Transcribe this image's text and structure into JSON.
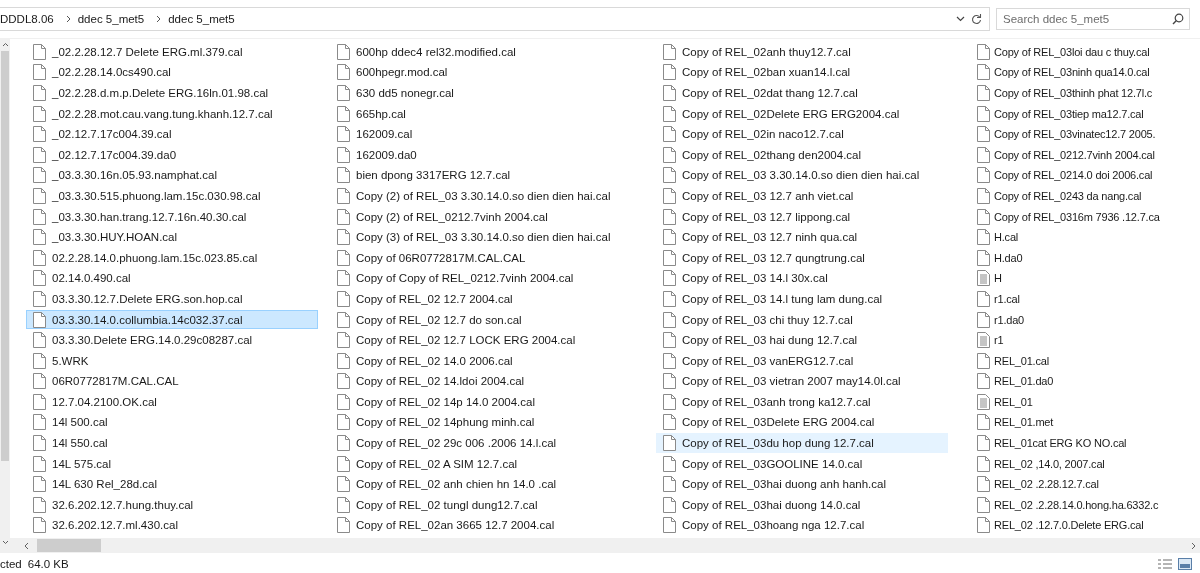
{
  "address_bar": {
    "breadcrumbs": [
      "DDDL8.06",
      "ddec 5_met5",
      "ddec 5_met5"
    ]
  },
  "search": {
    "placeholder": "Search ddec 5_met5"
  },
  "columns": [
    [
      {
        "name": "_02.2.28.12.7 Delete ERG.ml.379.cal",
        "kind": "file",
        "selected": false,
        "hot": false
      },
      {
        "name": "_02.2.28.14.0cs490.cal",
        "kind": "file",
        "selected": false,
        "hot": false
      },
      {
        "name": "_02.2.28.d.m.p.Delete ERG.16ln.01.98.cal",
        "kind": "file",
        "selected": false,
        "hot": false
      },
      {
        "name": "_02.2.28.mot.cau.vang.tung.khanh.12.7.cal",
        "kind": "file",
        "selected": false,
        "hot": false
      },
      {
        "name": "_02.12.7.17c004.39.cal",
        "kind": "file",
        "selected": false,
        "hot": false
      },
      {
        "name": "_02.12.7.17c004.39.da0",
        "kind": "file",
        "selected": false,
        "hot": false
      },
      {
        "name": "_03.3.30.16n.05.93.namphat.cal",
        "kind": "file",
        "selected": false,
        "hot": false
      },
      {
        "name": "_03.3.30.515.phuong.lam.15c.030.98.cal",
        "kind": "file",
        "selected": false,
        "hot": false
      },
      {
        "name": "_03.3.30.han.trang.12.7.16n.40.30.cal",
        "kind": "file",
        "selected": false,
        "hot": false
      },
      {
        "name": "_03.3.30.HUY.HOAN.cal",
        "kind": "file",
        "selected": false,
        "hot": false
      },
      {
        "name": "02.2.28.14.0.phuong.lam.15c.023.85.cal",
        "kind": "file",
        "selected": false,
        "hot": false
      },
      {
        "name": "02.14.0.490.cal",
        "kind": "file",
        "selected": false,
        "hot": false
      },
      {
        "name": "03.3.30.12.7.Delete ERG.son.hop.cal",
        "kind": "file",
        "selected": false,
        "hot": false
      },
      {
        "name": "03.3.30.14.0.collumbia.14c032.37.cal",
        "kind": "file",
        "selected": true,
        "hot": false
      },
      {
        "name": "03.3.30.Delete ERG.14.0.29c08287.cal",
        "kind": "file",
        "selected": false,
        "hot": false
      },
      {
        "name": "5.WRK",
        "kind": "file",
        "selected": false,
        "hot": false
      },
      {
        "name": "06R0772817M.CAL.CAL",
        "kind": "file",
        "selected": false,
        "hot": false
      },
      {
        "name": "12.7.04.2100.OK.cal",
        "kind": "file",
        "selected": false,
        "hot": false
      },
      {
        "name": "14l 500.cal",
        "kind": "file",
        "selected": false,
        "hot": false
      },
      {
        "name": "14l 550.cal",
        "kind": "file",
        "selected": false,
        "hot": false
      },
      {
        "name": "14L 575.cal",
        "kind": "file",
        "selected": false,
        "hot": false
      },
      {
        "name": "14L 630 Rel_28d.cal",
        "kind": "file",
        "selected": false,
        "hot": false
      },
      {
        "name": "32.6.202.12.7.hung.thuy.cal",
        "kind": "file",
        "selected": false,
        "hot": false
      },
      {
        "name": "32.6.202.12.7.ml.430.cal",
        "kind": "file",
        "selected": false,
        "hot": false
      }
    ],
    [
      {
        "name": "600hp ddec4 rel32.modified.cal",
        "kind": "file",
        "selected": false,
        "hot": false
      },
      {
        "name": "600hpegr.mod.cal",
        "kind": "file",
        "selected": false,
        "hot": false
      },
      {
        "name": "630 dd5 nonegr.cal",
        "kind": "file",
        "selected": false,
        "hot": false
      },
      {
        "name": "665hp.cal",
        "kind": "file",
        "selected": false,
        "hot": false
      },
      {
        "name": "162009.cal",
        "kind": "file",
        "selected": false,
        "hot": false
      },
      {
        "name": "162009.da0",
        "kind": "file",
        "selected": false,
        "hot": false
      },
      {
        "name": "bien dpong 3317ERG 12.7.cal",
        "kind": "file",
        "selected": false,
        "hot": false
      },
      {
        "name": "Copy (2) of REL_03 3.30.14.0.so dien dien hai.cal",
        "kind": "file",
        "selected": false,
        "hot": false
      },
      {
        "name": "Copy (2) of REL_0212.7vinh 2004.cal",
        "kind": "file",
        "selected": false,
        "hot": false
      },
      {
        "name": "Copy (3) of REL_03 3.30.14.0.so dien dien hai.cal",
        "kind": "file",
        "selected": false,
        "hot": false
      },
      {
        "name": "Copy of 06R0772817M.CAL.CAL",
        "kind": "file",
        "selected": false,
        "hot": false
      },
      {
        "name": "Copy of Copy of REL_0212.7vinh 2004.cal",
        "kind": "file",
        "selected": false,
        "hot": false
      },
      {
        "name": "Copy of REL_02 12.7 2004.cal",
        "kind": "file",
        "selected": false,
        "hot": false
      },
      {
        "name": "Copy of REL_02 12.7 do son.cal",
        "kind": "file",
        "selected": false,
        "hot": false
      },
      {
        "name": "Copy of REL_02 12.7 LOCK ERG 2004.cal",
        "kind": "file",
        "selected": false,
        "hot": false
      },
      {
        "name": "Copy of REL_02 14.0 2006.cal",
        "kind": "file",
        "selected": false,
        "hot": false
      },
      {
        "name": "Copy of REL_02 14.ldoi  2004.cal",
        "kind": "file",
        "selected": false,
        "hot": false
      },
      {
        "name": "Copy of REL_02 14p 14.0 2004.cal",
        "kind": "file",
        "selected": false,
        "hot": false
      },
      {
        "name": "Copy of REL_02 14phung minh.cal",
        "kind": "file",
        "selected": false,
        "hot": false
      },
      {
        "name": "Copy of REL_02 29c 006 .2006 14.l.cal",
        "kind": "file",
        "selected": false,
        "hot": false
      },
      {
        "name": "Copy of REL_02 A SIM 12.7.cal",
        "kind": "file",
        "selected": false,
        "hot": false
      },
      {
        "name": "Copy of REL_02 anh chien hn 14.0 .cal",
        "kind": "file",
        "selected": false,
        "hot": false
      },
      {
        "name": "Copy of REL_02 tungl dung12.7.cal",
        "kind": "file",
        "selected": false,
        "hot": false
      },
      {
        "name": "Copy of REL_02an 3665 12.7 2004.cal",
        "kind": "file",
        "selected": false,
        "hot": false
      }
    ],
    [
      {
        "name": "Copy of REL_02anh thuy12.7.cal",
        "kind": "file",
        "selected": false,
        "hot": false
      },
      {
        "name": "Copy of REL_02ban xuan14.l.cal",
        "kind": "file",
        "selected": false,
        "hot": false
      },
      {
        "name": "Copy of REL_02dat thang 12.7.cal",
        "kind": "file",
        "selected": false,
        "hot": false
      },
      {
        "name": "Copy of REL_02Delete ERG ERG2004.cal",
        "kind": "file",
        "selected": false,
        "hot": false
      },
      {
        "name": "Copy of REL_02in naco12.7.cal",
        "kind": "file",
        "selected": false,
        "hot": false
      },
      {
        "name": "Copy of REL_02thang den2004.cal",
        "kind": "file",
        "selected": false,
        "hot": false
      },
      {
        "name": "Copy of REL_03 3.30.14.0.so dien dien hai.cal",
        "kind": "file",
        "selected": false,
        "hot": false
      },
      {
        "name": "Copy of REL_03 12.7 anh viet.cal",
        "kind": "file",
        "selected": false,
        "hot": false
      },
      {
        "name": "Copy of REL_03 12.7 lippong.cal",
        "kind": "file",
        "selected": false,
        "hot": false
      },
      {
        "name": "Copy of REL_03 12.7 ninh qua.cal",
        "kind": "file",
        "selected": false,
        "hot": false
      },
      {
        "name": "Copy of REL_03 12.7 qungtrung.cal",
        "kind": "file",
        "selected": false,
        "hot": false
      },
      {
        "name": "Copy of REL_03 14.l 30x.cal",
        "kind": "file",
        "selected": false,
        "hot": false
      },
      {
        "name": "Copy of REL_03 14.l tung lam dung.cal",
        "kind": "file",
        "selected": false,
        "hot": false
      },
      {
        "name": "Copy of REL_03 chi thuy 12.7.cal",
        "kind": "file",
        "selected": false,
        "hot": false
      },
      {
        "name": "Copy of REL_03 hai dung 12.7.cal",
        "kind": "file",
        "selected": false,
        "hot": false
      },
      {
        "name": "Copy of REL_03 vanERG12.7.cal",
        "kind": "file",
        "selected": false,
        "hot": false
      },
      {
        "name": "Copy of REL_03 vietran 2007 may14.0l.cal",
        "kind": "file",
        "selected": false,
        "hot": false
      },
      {
        "name": "Copy of REL_03anh trong ka12.7.cal",
        "kind": "file",
        "selected": false,
        "hot": false
      },
      {
        "name": "Copy of REL_03Delete ERG 2004.cal",
        "kind": "file",
        "selected": false,
        "hot": false
      },
      {
        "name": "Copy of REL_03du hop dung 12.7.cal",
        "kind": "file",
        "selected": false,
        "hot": true
      },
      {
        "name": "Copy of REL_03GOOLINE 14.0.cal",
        "kind": "file",
        "selected": false,
        "hot": false
      },
      {
        "name": "Copy of REL_03hai duong  anh hanh.cal",
        "kind": "file",
        "selected": false,
        "hot": false
      },
      {
        "name": "Copy of REL_03hai duong 14.0.cal",
        "kind": "file",
        "selected": false,
        "hot": false
      },
      {
        "name": "Copy of REL_03hoang nga 12.7.cal",
        "kind": "file",
        "selected": false,
        "hot": false
      }
    ],
    [
      {
        "name": "Copy of REL_03loi dau c thuy.cal",
        "kind": "file",
        "selected": false,
        "hot": false
      },
      {
        "name": "Copy of REL_03ninh qua14.0.cal",
        "kind": "file",
        "selected": false,
        "hot": false
      },
      {
        "name": "Copy of REL_03thinh phat 12.7l.c",
        "kind": "file",
        "selected": false,
        "hot": false
      },
      {
        "name": "Copy of REL_03tiep ma12.7.cal",
        "kind": "file",
        "selected": false,
        "hot": false
      },
      {
        "name": "Copy of REL_03vinatec12.7 2005.",
        "kind": "file",
        "selected": false,
        "hot": false
      },
      {
        "name": "Copy of REL_0212.7vinh 2004.cal",
        "kind": "file",
        "selected": false,
        "hot": false
      },
      {
        "name": "Copy of REL_0214.0 doi 2006.cal",
        "kind": "file",
        "selected": false,
        "hot": false
      },
      {
        "name": "Copy of REL_0243 da nang.cal",
        "kind": "file",
        "selected": false,
        "hot": false
      },
      {
        "name": "Copy of REL_0316m 7936 .12.7.ca",
        "kind": "file",
        "selected": false,
        "hot": false
      },
      {
        "name": "H.cal",
        "kind": "file",
        "selected": false,
        "hot": false
      },
      {
        "name": "H.da0",
        "kind": "file",
        "selected": false,
        "hot": false
      },
      {
        "name": "H",
        "kind": "text",
        "selected": false,
        "hot": false
      },
      {
        "name": "r1.cal",
        "kind": "file",
        "selected": false,
        "hot": false
      },
      {
        "name": "r1.da0",
        "kind": "file",
        "selected": false,
        "hot": false
      },
      {
        "name": "r1",
        "kind": "text",
        "selected": false,
        "hot": false
      },
      {
        "name": "REL_01.cal",
        "kind": "file",
        "selected": false,
        "hot": false
      },
      {
        "name": "REL_01.da0",
        "kind": "file",
        "selected": false,
        "hot": false
      },
      {
        "name": "REL_01",
        "kind": "text",
        "selected": false,
        "hot": false
      },
      {
        "name": "REL_01.met",
        "kind": "file",
        "selected": false,
        "hot": false
      },
      {
        "name": "REL_01cat ERG KO NO.cal",
        "kind": "file",
        "selected": false,
        "hot": false
      },
      {
        "name": "REL_02 ,14.0, 2007.cal",
        "kind": "file",
        "selected": false,
        "hot": false
      },
      {
        "name": "REL_02 .2.28.12.7.cal",
        "kind": "file",
        "selected": false,
        "hot": false
      },
      {
        "name": "REL_02 .2.28.14.0.hong.ha.6332.c",
        "kind": "file",
        "selected": false,
        "hot": false
      },
      {
        "name": "REL_02 .12.7.0.Delete ERG.cal",
        "kind": "file",
        "selected": false,
        "hot": false
      }
    ]
  ],
  "status_bar": {
    "selection": "cted",
    "size": "64.0 KB"
  }
}
